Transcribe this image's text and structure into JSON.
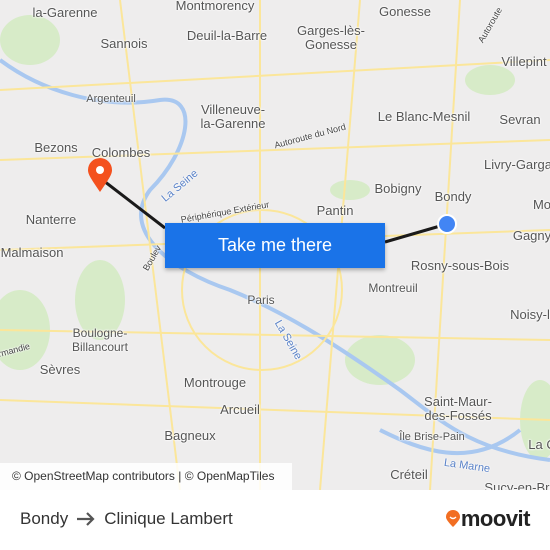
{
  "map": {
    "labels": [
      "la-Garenne",
      "Montmorency",
      "Gonesse",
      "Sannois",
      "Deuil-la-Barre",
      "Garges-lès-\nGonesse",
      "Villepint",
      "Argenteuil",
      "Villeneuve-\nla-Garenne",
      "Le Blanc-Mesnil",
      "Sevran",
      "Autoroute du Nord",
      "Bezons",
      "Colombes",
      "Livry-Garga",
      "Bobigny",
      "Bondy",
      "La Seine",
      "Périphérique Extérieur",
      "Pantin",
      "Nanterre",
      "Malmaison",
      "Gagny",
      "Rosny-sous-Bois",
      "Montreuil",
      "Paris",
      "Boulogne-\nBillancourt",
      "Noisy-l",
      "La Seine",
      "Sèvres",
      "Montrouge",
      "Saint-Maur-\ndes-Fossés",
      "Arcueil",
      "Bagneux",
      "Île Brise-Pain",
      "La Marne",
      "Créteil",
      "Sucy-en-Brie",
      "Autoroute",
      "Mo",
      "La C",
      "Boulev",
      "rmandie"
    ],
    "origin_marker_color": "#4285f4",
    "destination_marker_color": "#f4511e",
    "route_color": "#1a1a1a"
  },
  "attribution": "© OpenStreetMap contributors | © OpenMapTiles",
  "cta": {
    "label": "Take me there",
    "color": "#1a73e8"
  },
  "footer": {
    "origin": "Bondy",
    "arrow_icon": "arrow-right-icon",
    "destination": "Clinique Lambert",
    "brand": "moovit",
    "brand_color": "#f26e22"
  }
}
